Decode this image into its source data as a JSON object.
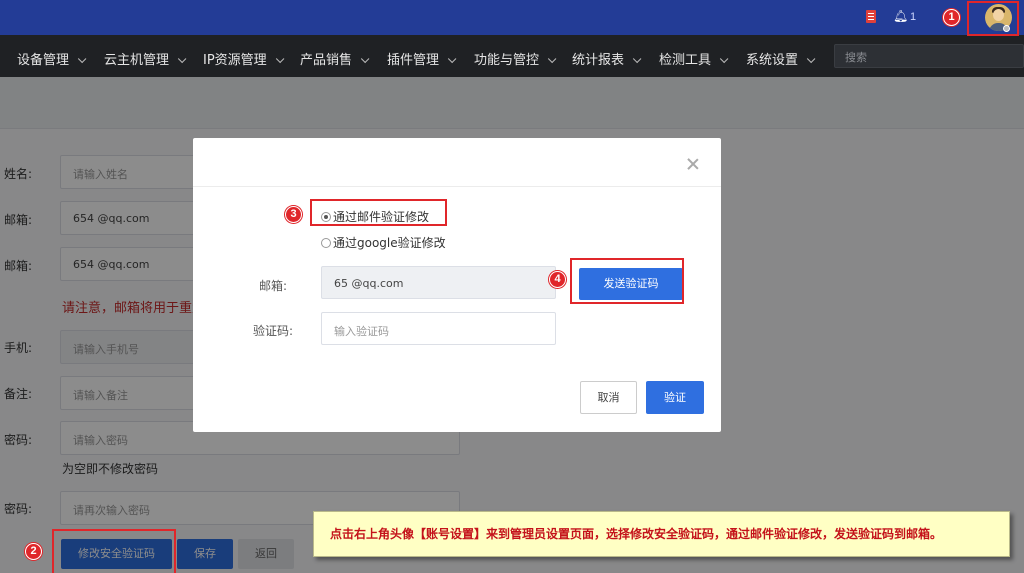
{
  "topbar": {
    "notification_count": "1",
    "icons": [
      "document-icon",
      "bell-icon",
      "avatar"
    ],
    "bg_color": "#233c96"
  },
  "nav": {
    "items": [
      "设备管理",
      "云主机管理",
      "IP资源管理",
      "产品销售",
      "插件管理",
      "功能与管控",
      "统计报表",
      "检测工具",
      "系统设置"
    ],
    "search_placeholder": "搜索"
  },
  "form": {
    "name_label": "姓名:",
    "name_placeholder": "请输入姓名",
    "email_label": "邮箱:",
    "email_value": "654        @qq.com",
    "email2_label": "邮箱:",
    "email2_value": "654        @qq.com",
    "email_warning": "请注意，邮箱将用于重置",
    "phone_label": "手机:",
    "phone_placeholder": "请输入手机号",
    "remark_label": "备注:",
    "remark_placeholder": "请输入备注",
    "password_label": "密码:",
    "password_placeholder": "请输入密码",
    "password_hint": "为空即不修改密码",
    "confirm_label": "密码:",
    "confirm_placeholder": "请再次输入密码",
    "modify_security_button": "修改安全验证码",
    "save_button": "保存",
    "back_button": "返回"
  },
  "modal": {
    "option_email": "通过邮件验证修改",
    "option_google": "通过google验证修改",
    "email_label": "邮箱:",
    "email_value": "65              @qq.com",
    "send_code_button": "发送验证码",
    "code_label": "验证码:",
    "code_placeholder": "输入验证码",
    "cancel_button": "取消",
    "verify_button": "验证"
  },
  "annotations": {
    "step1": "1",
    "step2": "2",
    "step3": "3",
    "step4": "4",
    "callout": "点击右上角头像【账号设置】来到管理员设置页面，选择修改安全验证码，通过邮件验证修改，发送验证码到邮箱。",
    "highlight_color": "#e0262a"
  }
}
